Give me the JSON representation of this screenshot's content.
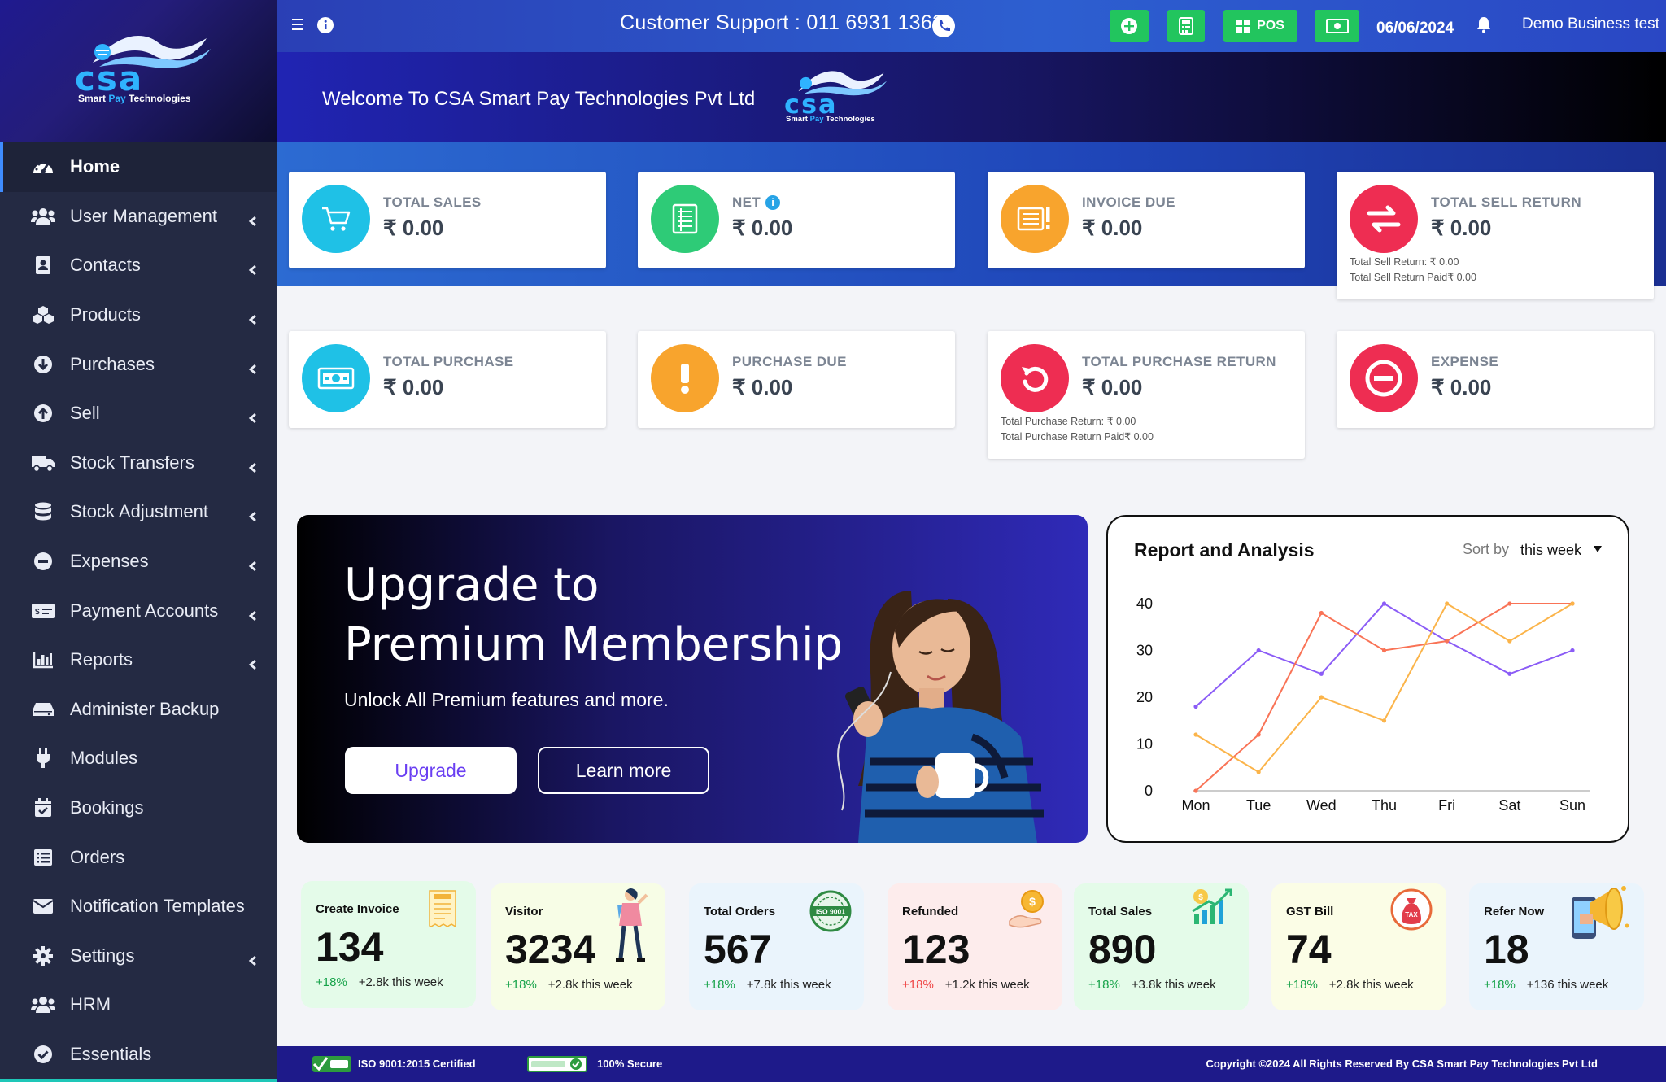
{
  "brand": {
    "logo_letters": "csa",
    "tagline_a": "Smart ",
    "tagline_b": "Pay",
    "tagline_c": " Technologies"
  },
  "sidebar": {
    "items": [
      {
        "label": "Home",
        "icon": "dashboard-icon",
        "chevron": false,
        "active": true
      },
      {
        "label": "User Management",
        "icon": "users-icon",
        "chevron": true
      },
      {
        "label": "Contacts",
        "icon": "address-book-icon",
        "chevron": true
      },
      {
        "label": "Products",
        "icon": "cubes-icon",
        "chevron": true
      },
      {
        "label": "Purchases",
        "icon": "arrow-circle-down-icon",
        "chevron": true
      },
      {
        "label": "Sell",
        "icon": "arrow-circle-up-icon",
        "chevron": true
      },
      {
        "label": "Stock Transfers",
        "icon": "truck-icon",
        "chevron": true
      },
      {
        "label": "Stock Adjustment",
        "icon": "database-icon",
        "chevron": true
      },
      {
        "label": "Expenses",
        "icon": "minus-circle-icon",
        "chevron": true
      },
      {
        "label": "Payment Accounts",
        "icon": "money-check-icon",
        "chevron": true
      },
      {
        "label": "Reports",
        "icon": "bar-chart-icon",
        "chevron": true
      },
      {
        "label": "Administer Backup",
        "icon": "hdd-icon",
        "chevron": false
      },
      {
        "label": "Modules",
        "icon": "plug-icon",
        "chevron": false
      },
      {
        "label": "Bookings",
        "icon": "calendar-check-icon",
        "chevron": false
      },
      {
        "label": "Orders",
        "icon": "list-alt-icon",
        "chevron": false
      },
      {
        "label": "Notification Templates",
        "icon": "envelope-icon",
        "chevron": false
      },
      {
        "label": "Settings",
        "icon": "cog-icon",
        "chevron": true
      },
      {
        "label": "HRM",
        "icon": "users-icon",
        "chevron": false
      },
      {
        "label": "Essentials",
        "icon": "check-circle-icon",
        "chevron": false
      }
    ]
  },
  "topbar": {
    "support": "Customer Support : 011 6931 1363",
    "pos_label": "POS",
    "date": "06/06/2024",
    "user": "Demo Business test"
  },
  "welcome": {
    "text": "Welcome To CSA Smart Pay Technologies Pvt Ltd"
  },
  "stats": {
    "total_sales": {
      "label": "TOTAL SALES",
      "value": "₹ 0.00",
      "color": "#1fc1e6"
    },
    "net": {
      "label": "NET",
      "value": "₹ 0.00",
      "color": "#2ecb77"
    },
    "invoice_due": {
      "label": "INVOICE DUE",
      "value": "₹ 0.00",
      "color": "#f8a42d"
    },
    "total_sell_return": {
      "label": "TOTAL SELL RETURN",
      "value": "₹ 0.00",
      "color": "#ee2d52",
      "sub1": "Total Sell Return: ₹ 0.00",
      "sub2": "Total Sell Return Paid₹ 0.00"
    },
    "total_purchase": {
      "label": "TOTAL PURCHASE",
      "value": "₹ 0.00",
      "color": "#1fc1e6"
    },
    "purchase_due": {
      "label": "PURCHASE DUE",
      "value": "₹ 0.00",
      "color": "#f8a42d"
    },
    "total_purchase_return": {
      "label": "TOTAL PURCHASE RETURN",
      "value": "₹ 0.00",
      "color": "#ee2d52",
      "sub1": "Total Purchase Return: ₹ 0.00",
      "sub2": "Total Purchase Return Paid₹ 0.00"
    },
    "expense": {
      "label": "EXPENSE",
      "value": "₹ 0.00",
      "color": "#ee2d52"
    }
  },
  "premium": {
    "title_line1": "Upgrade to",
    "title_line2": "Premium Membership",
    "subtitle": "Unlock All Premium features and more.",
    "upgrade_label": "Upgrade",
    "learn_label": "Learn more"
  },
  "report": {
    "title": "Report and Analysis",
    "sort_label": "Sort by",
    "sort_value": "this week"
  },
  "chart_data": {
    "type": "line",
    "categories": [
      "Mon",
      "Tue",
      "Wed",
      "Thu",
      "Fri",
      "Sat",
      "Sun"
    ],
    "ylim": [
      0,
      40
    ],
    "yticks": [
      0,
      10,
      20,
      30,
      40
    ],
    "series": [
      {
        "color": "#8b5cf6",
        "values": [
          18,
          30,
          25,
          40,
          32,
          25,
          30
        ]
      },
      {
        "color": "#f97356",
        "values": [
          0,
          12,
          38,
          30,
          32,
          40,
          40
        ]
      },
      {
        "color": "#fbb44a",
        "values": [
          12,
          4,
          20,
          15,
          40,
          32,
          40
        ]
      }
    ]
  },
  "mini_cards": [
    {
      "title": "Create Invoice",
      "value": "134",
      "pct": "+18%",
      "week": "+2.8k this week",
      "bg": "#e4fbe9",
      "pct_color": "#17a34a",
      "art": "invoice-icon"
    },
    {
      "title": "Visitor",
      "value": "3234",
      "pct": "+18%",
      "week": "+2.8k this week",
      "bg": "#f7fde6",
      "pct_color": "#17a34a",
      "art": "visitor-icon"
    },
    {
      "title": "Total Orders",
      "value": "567",
      "pct": "+18%",
      "week": "+7.8k this week",
      "bg": "#eaf4fc",
      "pct_color": "#17a34a",
      "art": "iso-badge-icon"
    },
    {
      "title": "Refunded",
      "value": "123",
      "pct": "+18%",
      "week": "+1.2k this week",
      "bg": "#fdecec",
      "pct_color": "#ef4444",
      "art": "refund-icon"
    },
    {
      "title": "Total Sales",
      "value": "890",
      "pct": "+18%",
      "week": "+3.8k this week",
      "bg": "#e4fbe9",
      "pct_color": "#17a34a",
      "art": "growth-icon"
    },
    {
      "title": "GST Bill",
      "value": "74",
      "pct": "+18%",
      "week": "+2.8k this week",
      "bg": "#fbfde6",
      "pct_color": "#17a34a",
      "art": "tax-bag-icon"
    },
    {
      "title": "Refer Now",
      "value": "18",
      "pct": "+18%",
      "week": "+136 this week",
      "bg": "#eaf4fc",
      "pct_color": "#17a34a",
      "art": "megaphone-icon"
    }
  ],
  "footer": {
    "iso": "ISO 9001:2015 Certified",
    "secure": "100% Secure",
    "copyright": "Copyright ©2024 All Rights Reserved By CSA Smart Pay Technologies Pvt Ltd"
  }
}
